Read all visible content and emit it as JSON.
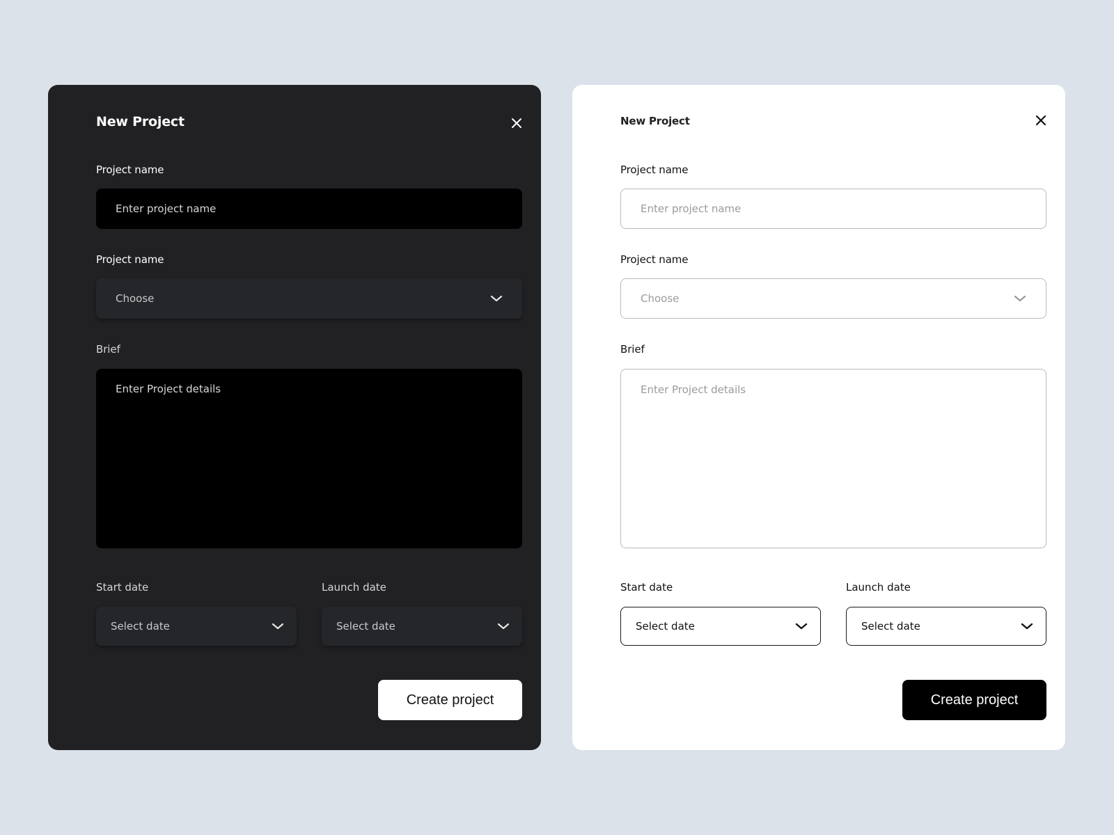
{
  "dark_modal": {
    "title": "New Project",
    "project_name_label": "Project name",
    "project_name_placeholder": "Enter project name",
    "select_label": "Project name",
    "select_value": "Choose",
    "brief_label": "Brief",
    "brief_placeholder": "Enter Project details",
    "start_date_label": "Start date",
    "start_date_value": "Select date",
    "launch_date_label": "Launch date",
    "launch_date_value": "Select date",
    "create_button": "Create project"
  },
  "light_modal": {
    "title": "New Project",
    "project_name_label": "Project name",
    "project_name_placeholder": "Enter project name",
    "select_label": "Project name",
    "select_value": "Choose",
    "brief_label": "Brief",
    "brief_placeholder": "Enter Project details",
    "start_date_label": "Start date",
    "start_date_value": "Select date",
    "launch_date_label": "Launch date",
    "launch_date_value": "Select date",
    "create_button": "Create project"
  },
  "icons": {
    "close": "close-icon",
    "dropdown": "chevron-down-icon"
  },
  "colors": {
    "page_background": "#dbe2ea",
    "dark_panel": "#212124",
    "light_panel": "#ffffff",
    "dark_button": "#ffffff",
    "light_button": "#000000"
  }
}
